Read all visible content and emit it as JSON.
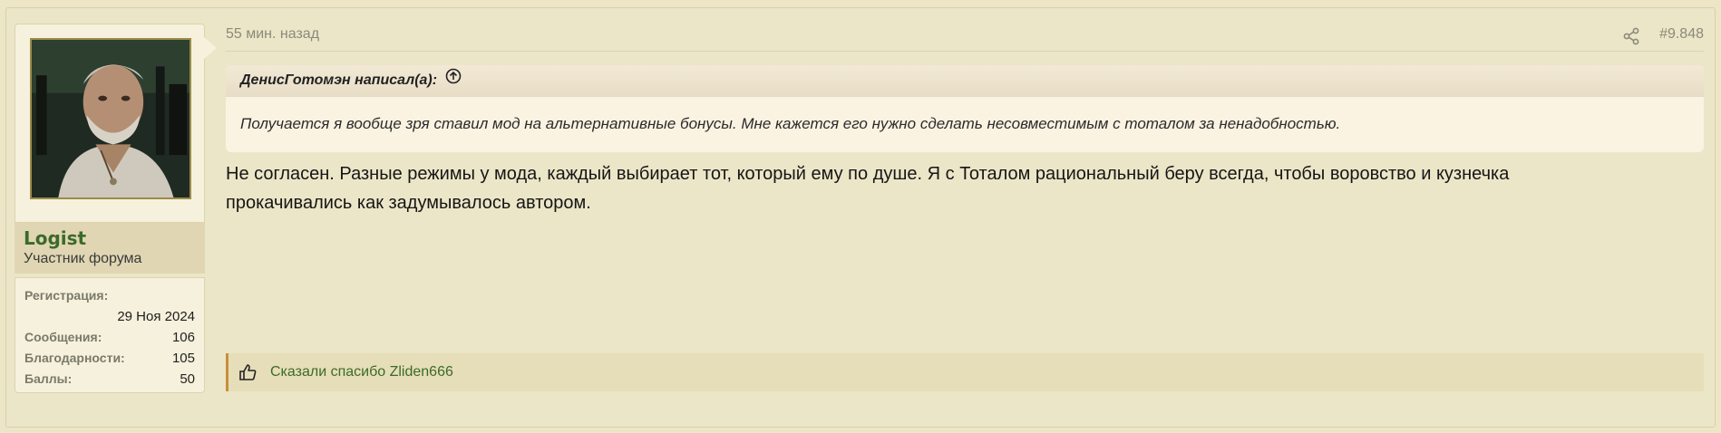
{
  "post": {
    "time": "55 мин. назад",
    "number": "#9.848",
    "share_icon": "share-icon"
  },
  "author": {
    "name": "Logist",
    "title": "Участник форума",
    "stats": {
      "reg_label": "Регистрация:",
      "reg_value": "29 Ноя 2024",
      "messages_label": "Сообщения:",
      "messages_value": "106",
      "thanks_label": "Благодарности:",
      "thanks_value": "105",
      "points_label": "Баллы:",
      "points_value": "50"
    }
  },
  "quote": {
    "author_line": "ДенисГотомэн написал(а):",
    "text": "Получается я вообще зря ставил мод на альтернативные бонусы. Мне кажется его нужно сделать несовместимым с тоталом за ненадобностью."
  },
  "message": {
    "line1": "Не согласен. Разные режимы у мода, каждый выбирает тот, который ему по душе. Я с Тоталом рациональный беру всегда, чтобы воровство и кузнечка",
    "line2": "прокачивались как задумывалось автором."
  },
  "reactions": {
    "text": "Сказали спасибо Zliden666"
  },
  "colors": {
    "background": "#ece5c6",
    "username": "#3b6a2a",
    "reaction_accent": "#c7903b"
  }
}
